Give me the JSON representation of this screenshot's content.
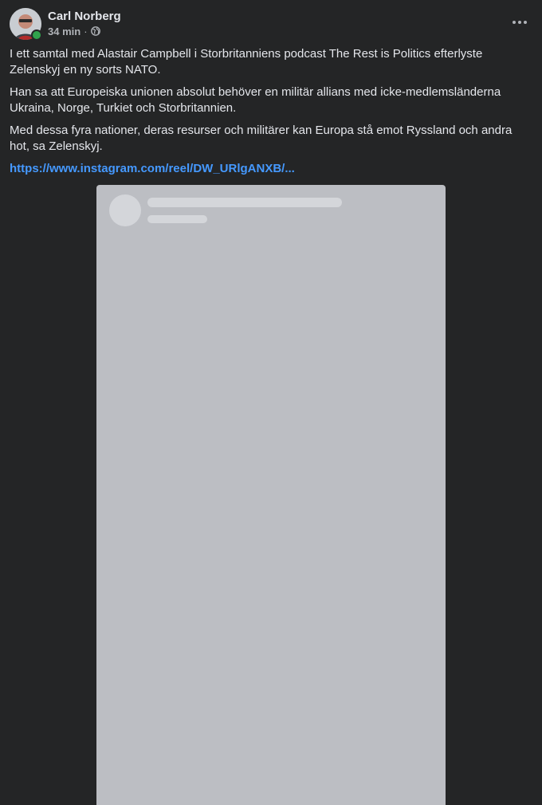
{
  "post": {
    "author": "Carl Norberg",
    "time": "34 min",
    "separator": "·",
    "audience_icon": "globe-icon",
    "online": true,
    "paragraphs": [
      "I ett samtal med Alastair Campbell i Storbritanniens podcast The Rest is Politics efterlyste Zelenskyj en ny sorts NATO.",
      "Han sa att Europeiska unionen absolut behöver en militär allians med icke-medlemsländerna Ukraina, Norge, Turkiet och Storbritannien.",
      "Med dessa fyra nationer, deras resurser och militärer kan Europa stå emot Ryssland och andra hot, sa Zelenskyj."
    ],
    "link_text": "https://www.instagram.com/reel/DW_URlgANXB/..."
  },
  "icons": {
    "more": "more-horizontal-icon",
    "globe": "globe-icon"
  },
  "colors": {
    "background": "#242526",
    "text": "#e4e6eb",
    "secondary_text": "#b0b3b8",
    "link": "#4599ff",
    "online": "#31a24c",
    "embed_placeholder": "#bcbec3"
  }
}
